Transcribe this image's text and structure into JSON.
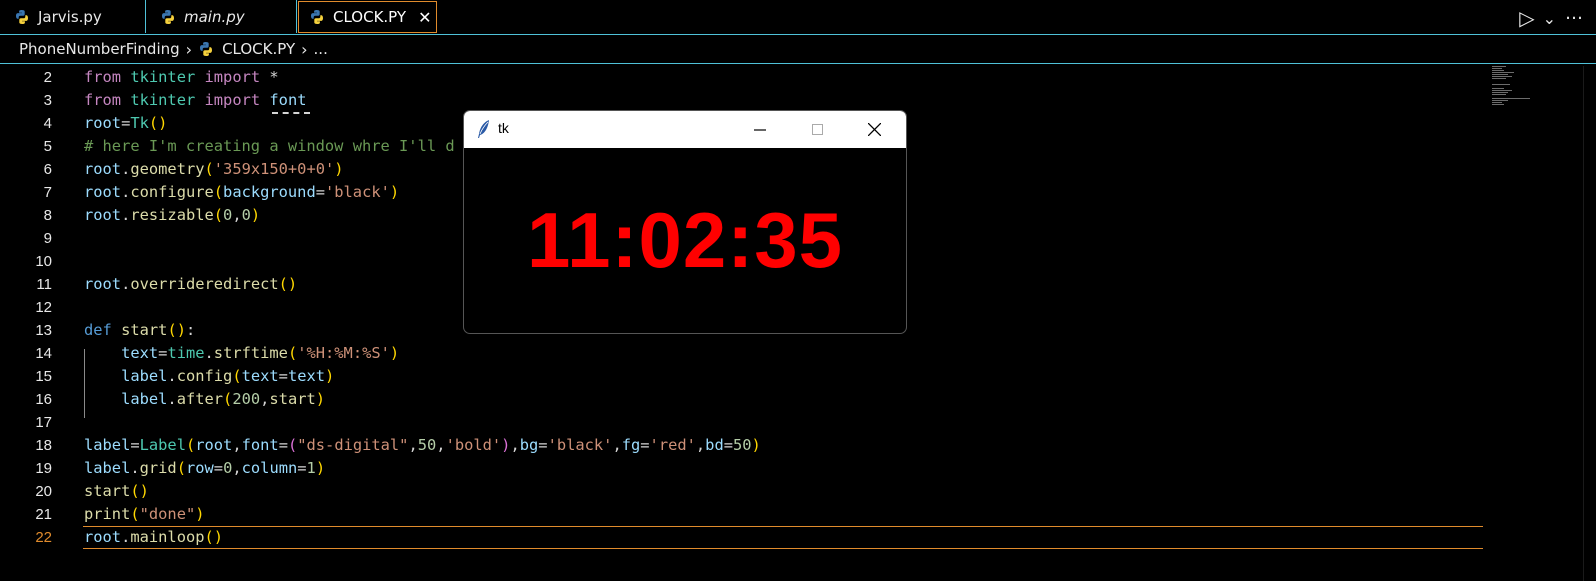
{
  "tabs": [
    {
      "label": "Jarvis.py",
      "icon": "python-icon"
    },
    {
      "label": "main.py",
      "icon": "python-icon"
    },
    {
      "label": "CLOCK.PY",
      "icon": "python-icon",
      "close": "✕"
    }
  ],
  "toolbar": {
    "run_icon": "▷",
    "run_dropdown": "⌄",
    "more": "…"
  },
  "breadcrumb": {
    "folder": "PhoneNumberFinding",
    "file": "CLOCK.PY",
    "tail": "..."
  },
  "editor": {
    "lines": [
      {
        "n": "2",
        "tokens": [
          [
            "kw",
            "from"
          ],
          [
            "plain",
            " "
          ],
          [
            "mod",
            "tkinter"
          ],
          [
            "plain",
            " "
          ],
          [
            "kw",
            "import"
          ],
          [
            "plain",
            " *"
          ]
        ]
      },
      {
        "n": "3",
        "tokens": [
          [
            "kw",
            "from"
          ],
          [
            "plain",
            " "
          ],
          [
            "mod",
            "tkinter"
          ],
          [
            "plain",
            " "
          ],
          [
            "kw",
            "import"
          ],
          [
            "plain",
            " "
          ],
          [
            "var",
            "font"
          ]
        ]
      },
      {
        "n": "4",
        "tokens": [
          [
            "var",
            "root"
          ],
          [
            "plain",
            "="
          ],
          [
            "mod",
            "Tk"
          ],
          [
            "br1",
            "()"
          ]
        ]
      },
      {
        "n": "5",
        "tokens": [
          [
            "cmt",
            "# here I'm creating a window whre I'll d"
          ]
        ]
      },
      {
        "n": "6",
        "tokens": [
          [
            "var",
            "root"
          ],
          [
            "plain",
            "."
          ],
          [
            "fn",
            "geometry"
          ],
          [
            "br1",
            "("
          ],
          [
            "str",
            "'359x150+0+0'"
          ],
          [
            "br1",
            ")"
          ]
        ]
      },
      {
        "n": "7",
        "tokens": [
          [
            "var",
            "root"
          ],
          [
            "plain",
            "."
          ],
          [
            "fn",
            "configure"
          ],
          [
            "br1",
            "("
          ],
          [
            "var",
            "background"
          ],
          [
            "plain",
            "="
          ],
          [
            "str",
            "'black'"
          ],
          [
            "br1",
            ")"
          ]
        ]
      },
      {
        "n": "8",
        "tokens": [
          [
            "var",
            "root"
          ],
          [
            "plain",
            "."
          ],
          [
            "fn",
            "resizable"
          ],
          [
            "br1",
            "("
          ],
          [
            "num",
            "0"
          ],
          [
            "plain",
            ","
          ],
          [
            "num",
            "0"
          ],
          [
            "br1",
            ")"
          ]
        ]
      },
      {
        "n": "9",
        "tokens": []
      },
      {
        "n": "10",
        "tokens": []
      },
      {
        "n": "11",
        "tokens": [
          [
            "var",
            "root"
          ],
          [
            "plain",
            "."
          ],
          [
            "fn",
            "overrideredirect"
          ],
          [
            "br1",
            "()"
          ]
        ]
      },
      {
        "n": "12",
        "tokens": []
      },
      {
        "n": "13",
        "tokens": [
          [
            "def",
            "def"
          ],
          [
            "plain",
            " "
          ],
          [
            "fn",
            "start"
          ],
          [
            "br1",
            "()"
          ],
          [
            "plain",
            ":"
          ]
        ]
      },
      {
        "n": "14",
        "tokens": [
          [
            "plain",
            "    "
          ],
          [
            "var",
            "text"
          ],
          [
            "plain",
            "="
          ],
          [
            "mod",
            "time"
          ],
          [
            "plain",
            "."
          ],
          [
            "fn",
            "strftime"
          ],
          [
            "br1",
            "("
          ],
          [
            "str",
            "'%H:%M:%S'"
          ],
          [
            "br1",
            ")"
          ]
        ]
      },
      {
        "n": "15",
        "tokens": [
          [
            "plain",
            "    "
          ],
          [
            "var",
            "label"
          ],
          [
            "plain",
            "."
          ],
          [
            "fn",
            "config"
          ],
          [
            "br1",
            "("
          ],
          [
            "var",
            "text"
          ],
          [
            "plain",
            "="
          ],
          [
            "var",
            "text"
          ],
          [
            "br1",
            ")"
          ]
        ]
      },
      {
        "n": "16",
        "tokens": [
          [
            "plain",
            "    "
          ],
          [
            "var",
            "label"
          ],
          [
            "plain",
            "."
          ],
          [
            "fn",
            "after"
          ],
          [
            "br1",
            "("
          ],
          [
            "num",
            "200"
          ],
          [
            "plain",
            ","
          ],
          [
            "fn",
            "start"
          ],
          [
            "br1",
            ")"
          ]
        ]
      },
      {
        "n": "17",
        "tokens": []
      },
      {
        "n": "18",
        "tokens": [
          [
            "var",
            "label"
          ],
          [
            "plain",
            "="
          ],
          [
            "mod",
            "Label"
          ],
          [
            "br1",
            "("
          ],
          [
            "var",
            "root"
          ],
          [
            "plain",
            ","
          ],
          [
            "var",
            "font"
          ],
          [
            "plain",
            "="
          ],
          [
            "br2",
            "("
          ],
          [
            "str",
            "\"ds-digital\""
          ],
          [
            "plain",
            ","
          ],
          [
            "num",
            "50"
          ],
          [
            "plain",
            ","
          ],
          [
            "str",
            "'bold'"
          ],
          [
            "br2",
            ")"
          ],
          [
            "plain",
            ","
          ],
          [
            "var",
            "bg"
          ],
          [
            "plain",
            "="
          ],
          [
            "str",
            "'black'"
          ],
          [
            "plain",
            ","
          ],
          [
            "var",
            "fg"
          ],
          [
            "plain",
            "="
          ],
          [
            "str",
            "'red'"
          ],
          [
            "plain",
            ","
          ],
          [
            "var",
            "bd"
          ],
          [
            "plain",
            "="
          ],
          [
            "num",
            "50"
          ],
          [
            "br1",
            ")"
          ]
        ]
      },
      {
        "n": "19",
        "tokens": [
          [
            "var",
            "label"
          ],
          [
            "plain",
            "."
          ],
          [
            "fn",
            "grid"
          ],
          [
            "br1",
            "("
          ],
          [
            "var",
            "row"
          ],
          [
            "plain",
            "="
          ],
          [
            "num",
            "0"
          ],
          [
            "plain",
            ","
          ],
          [
            "var",
            "column"
          ],
          [
            "plain",
            "="
          ],
          [
            "num",
            "1"
          ],
          [
            "br1",
            ")"
          ]
        ]
      },
      {
        "n": "20",
        "tokens": [
          [
            "fn",
            "start"
          ],
          [
            "br1",
            "()"
          ]
        ]
      },
      {
        "n": "21",
        "tokens": [
          [
            "fn",
            "print"
          ],
          [
            "br1",
            "("
          ],
          [
            "str",
            "\"done\""
          ],
          [
            "br1",
            ")"
          ]
        ]
      },
      {
        "n": "22",
        "tokens": [
          [
            "var",
            "root"
          ],
          [
            "plain",
            "."
          ],
          [
            "fn",
            "mainloop"
          ],
          [
            "br1",
            "()"
          ]
        ]
      }
    ],
    "current_line": "22"
  },
  "tk_window": {
    "title": "tk",
    "clock": "11:02:35",
    "clock_color": "#ff0000",
    "minimize": "—",
    "maximize": "☐",
    "close": "✕"
  },
  "colors": {
    "accent": "#e08b2c",
    "border": "#4fc1d8"
  }
}
